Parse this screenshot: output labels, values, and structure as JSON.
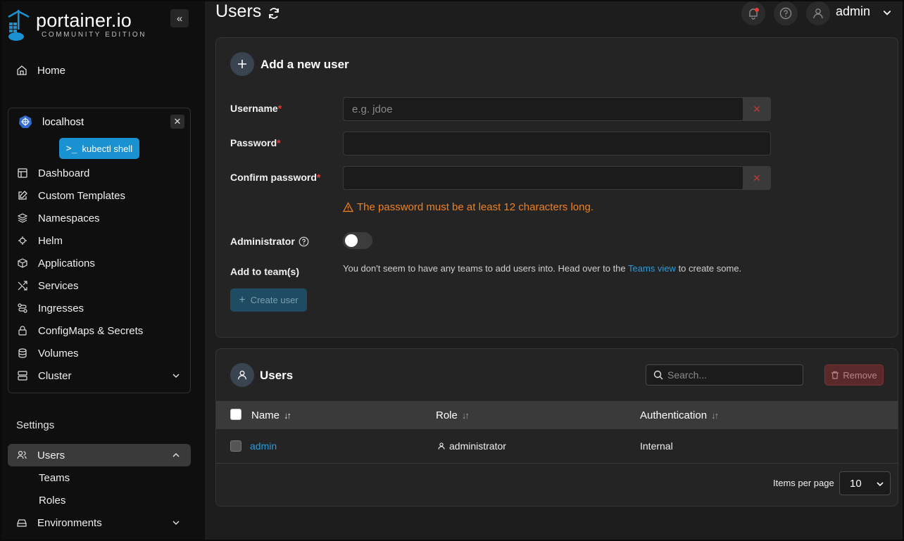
{
  "brand": {
    "name": "portainer.io",
    "edition": "COMMUNITY EDITION"
  },
  "sidebar": {
    "home": "Home",
    "environment": {
      "name": "localhost",
      "shell_button": "kubectl shell"
    },
    "env_items": [
      {
        "label": "Dashboard",
        "icon": "dashboard-icon"
      },
      {
        "label": "Custom Templates",
        "icon": "edit-icon"
      },
      {
        "label": "Namespaces",
        "icon": "layers-icon"
      },
      {
        "label": "Helm",
        "icon": "helm-icon"
      },
      {
        "label": "Applications",
        "icon": "box-icon"
      },
      {
        "label": "Services",
        "icon": "shuffle-icon"
      },
      {
        "label": "Ingresses",
        "icon": "route-icon"
      },
      {
        "label": "ConfigMaps & Secrets",
        "icon": "lock-icon"
      },
      {
        "label": "Volumes",
        "icon": "database-icon"
      },
      {
        "label": "Cluster",
        "icon": "server-icon"
      }
    ],
    "settings_title": "Settings",
    "settings_items": {
      "users": "Users",
      "teams": "Teams",
      "roles": "Roles",
      "environments": "Environments"
    }
  },
  "header": {
    "title": "Users",
    "username": "admin"
  },
  "add_user": {
    "title": "Add a new user",
    "username_label": "Username",
    "username_placeholder": "e.g. jdoe",
    "password_label": "Password",
    "confirm_label": "Confirm password",
    "required_mark": "*",
    "warning": "The password must be at least 12 characters long.",
    "admin_label": "Administrator",
    "admin_enabled": false,
    "team_label": "Add to team(s)",
    "team_hint_prefix": "You don't seem to have any teams to add users into. Head over to the ",
    "team_hint_link": "Teams view",
    "team_hint_suffix": " to create some.",
    "create_button": "Create user"
  },
  "users_table": {
    "title": "Users",
    "search_placeholder": "Search...",
    "remove_button": "Remove",
    "columns": [
      "Name",
      "Role",
      "Authentication"
    ],
    "rows": [
      {
        "name": "admin",
        "role": "administrator",
        "auth": "Internal"
      }
    ],
    "items_per_page_label": "Items per page",
    "items_per_page": "10"
  },
  "colors": {
    "accent": "#1a91d0",
    "link": "#2e9ad8",
    "warning": "#f0801f",
    "danger": "#e63b3b"
  }
}
